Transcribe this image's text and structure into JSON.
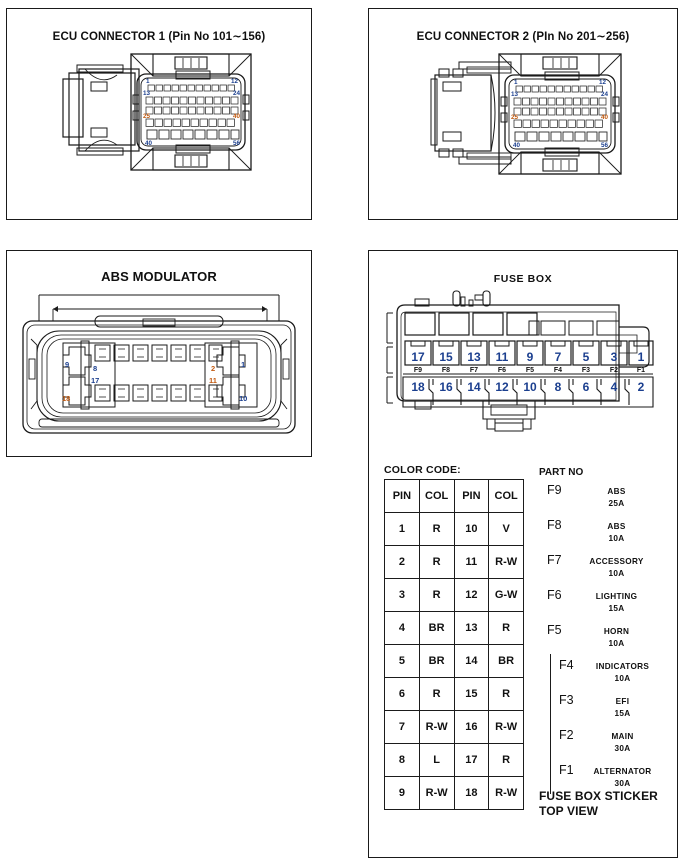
{
  "panels": {
    "ecu1": {
      "title": "ECU CONNECTOR 1 (Pin No 101∼156)"
    },
    "ecu2": {
      "title": "ECU CONNECTOR 2 (PIn No 201∼256)"
    },
    "abs": {
      "title": "ABS MODULATOR"
    },
    "fuse": {
      "title": "FUSE BOX"
    }
  },
  "abs_modulator": {
    "pins_left": [
      "9",
      "18"
    ],
    "pins_right": [
      "1",
      "10"
    ],
    "pins_mid_top": [
      "8",
      "2"
    ],
    "pins_mid_bottom": [
      "17",
      "11"
    ]
  },
  "fuse_box": {
    "top_row": [
      "17",
      "15",
      "13",
      "11",
      "9",
      "7",
      "5",
      "3",
      "1"
    ],
    "fuse_labels": [
      "F9",
      "F8",
      "F7",
      "F6",
      "F5",
      "F4",
      "F3",
      "F2",
      "F1"
    ],
    "bottom_row": [
      "18",
      "16",
      "14",
      "12",
      "10",
      "8",
      "6",
      "4",
      "2"
    ]
  },
  "color_code": {
    "label": "COLOR CODE:",
    "headers": [
      "PIN",
      "COL",
      "PIN",
      "COL"
    ],
    "rows": [
      [
        "1",
        "R",
        "10",
        "V"
      ],
      [
        "2",
        "R",
        "11",
        "R-W"
      ],
      [
        "3",
        "R",
        "12",
        "G-W"
      ],
      [
        "4",
        "BR",
        "13",
        "R"
      ],
      [
        "5",
        "BR",
        "14",
        "BR"
      ],
      [
        "6",
        "R",
        "15",
        "R"
      ],
      [
        "7",
        "R-W",
        "16",
        "R-W"
      ],
      [
        "8",
        "L",
        "17",
        "R"
      ],
      [
        "9",
        "R-W",
        "18",
        "R-W"
      ]
    ]
  },
  "part_no": {
    "header": "PART NO",
    "rows": [
      {
        "id": "F9",
        "name": "ABS",
        "amps": "25A",
        "inset": false
      },
      {
        "id": "F8",
        "name": "ABS",
        "amps": "10A",
        "inset": false
      },
      {
        "id": "F7",
        "name": "ACCESSORY",
        "amps": "10A",
        "inset": false
      },
      {
        "id": "F6",
        "name": "LIGHTING",
        "amps": "15A",
        "inset": false
      },
      {
        "id": "F5",
        "name": "HORN",
        "amps": "10A",
        "inset": false
      },
      {
        "id": "F4",
        "name": "INDICATORS",
        "amps": "10A",
        "inset": true
      },
      {
        "id": "F3",
        "name": "EFI",
        "amps": "15A",
        "inset": true
      },
      {
        "id": "F2",
        "name": "MAIN",
        "amps": "30A",
        "inset": true
      },
      {
        "id": "F1",
        "name": "ALTERNATOR",
        "amps": "30A",
        "inset": true
      }
    ],
    "footer_line1": "FUSE BOX STICKER",
    "footer_line2": "TOP VIEW"
  },
  "ecu_pin_markers": {
    "conn1": [
      "1",
      "12",
      "13",
      "24",
      "25",
      "40",
      "40",
      "56"
    ],
    "conn2": [
      "1",
      "12",
      "13",
      "24",
      "25",
      "40",
      "40",
      "56"
    ]
  },
  "colors": {
    "outline": "#1a1a1a",
    "pin_number_blue": "#1b3f8f",
    "pin_number_orange": "#c25a10",
    "background": "#ffffff"
  }
}
